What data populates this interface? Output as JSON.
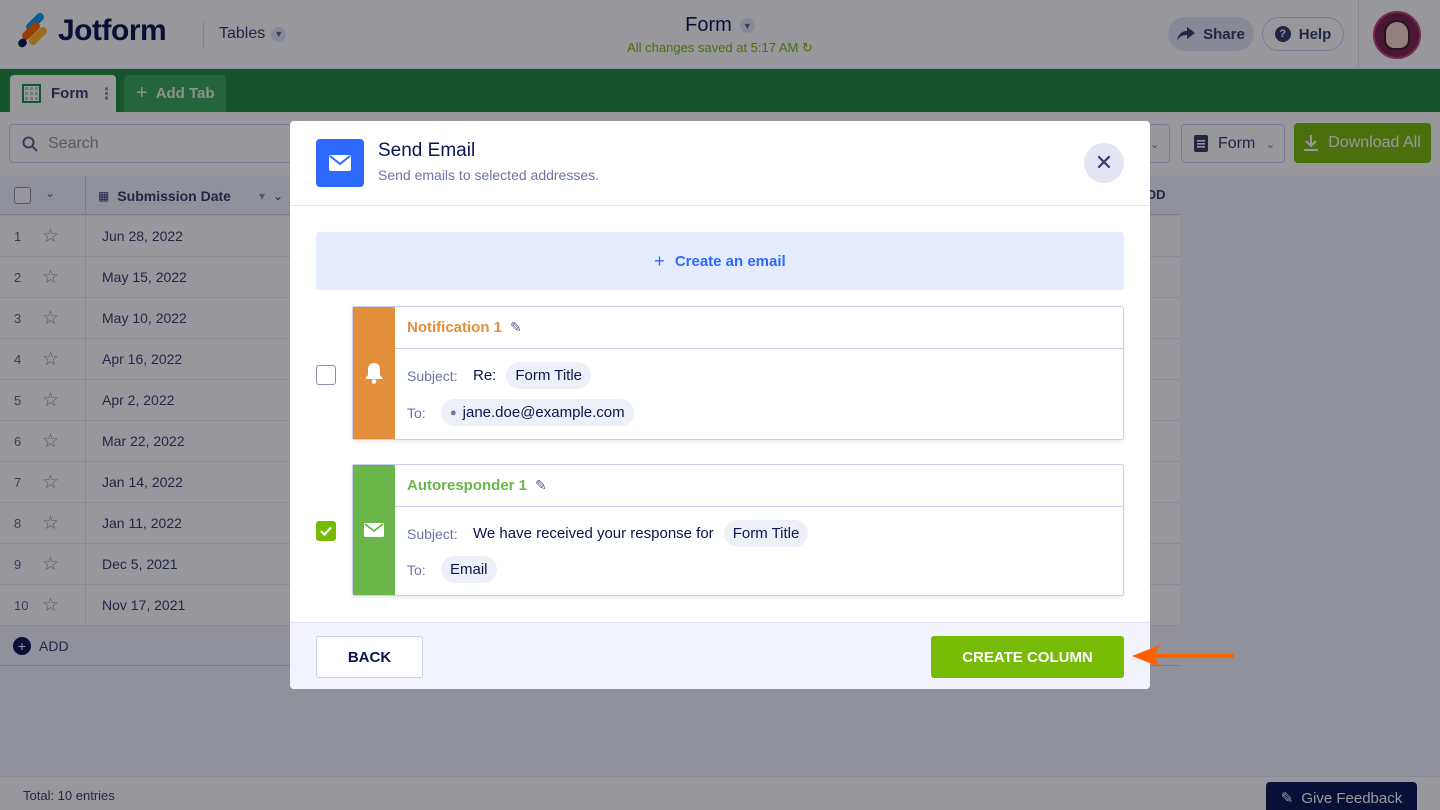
{
  "app": {
    "logo_text": "Jotform",
    "tables_menu": "Tables",
    "form_title": "Form",
    "saved_status": "All changes saved at 5:17 AM",
    "share_label": "Share",
    "help_label": "Help"
  },
  "tabs": {
    "active_tab": "Form",
    "add_tab": "Add Tab"
  },
  "toolbar": {
    "search_placeholder": "Search",
    "form_select": "Form",
    "download_label": "Download All"
  },
  "table": {
    "column_header": "Submission Date",
    "partial_header": "OD",
    "rows": [
      {
        "num": "1",
        "date": "Jun 28, 2022"
      },
      {
        "num": "2",
        "date": "May 15, 2022"
      },
      {
        "num": "3",
        "date": "May 10, 2022"
      },
      {
        "num": "4",
        "date": "Apr 16, 2022"
      },
      {
        "num": "5",
        "date": "Apr 2, 2022"
      },
      {
        "num": "6",
        "date": "Mar 22, 2022"
      },
      {
        "num": "7",
        "date": "Jan 14, 2022"
      },
      {
        "num": "8",
        "date": "Jan 11, 2022"
      },
      {
        "num": "9",
        "date": "Dec 5, 2021"
      },
      {
        "num": "10",
        "date": "Nov 17, 2021"
      }
    ],
    "add_label": "ADD"
  },
  "footer": {
    "total": "Total: 10 entries",
    "feedback": "Give Feedback"
  },
  "modal": {
    "title": "Send Email",
    "subtitle": "Send emails to selected addresses.",
    "create_email": "Create an email",
    "notification": {
      "name": "Notification 1",
      "subject_label": "Subject:",
      "subject_prefix": "Re:",
      "subject_chip": "Form Title",
      "to_label": "To:",
      "to_chip": "jane.doe@example.com",
      "checked": false,
      "color": "#e28e3b"
    },
    "autoresponder": {
      "name": "Autoresponder 1",
      "subject_label": "Subject:",
      "subject_text": "We have received your response for",
      "subject_chip": "Form Title",
      "to_label": "To:",
      "to_chip": "Email",
      "checked": true,
      "color": "#6bb64b"
    },
    "back_label": "BACK",
    "create_label": "CREATE COLUMN"
  },
  "colors": {
    "brand_green": "#1f8a3d",
    "accent_green": "#78bb07",
    "accent_blue": "#2e69ff",
    "annotation_arrow": "#ff6100"
  }
}
